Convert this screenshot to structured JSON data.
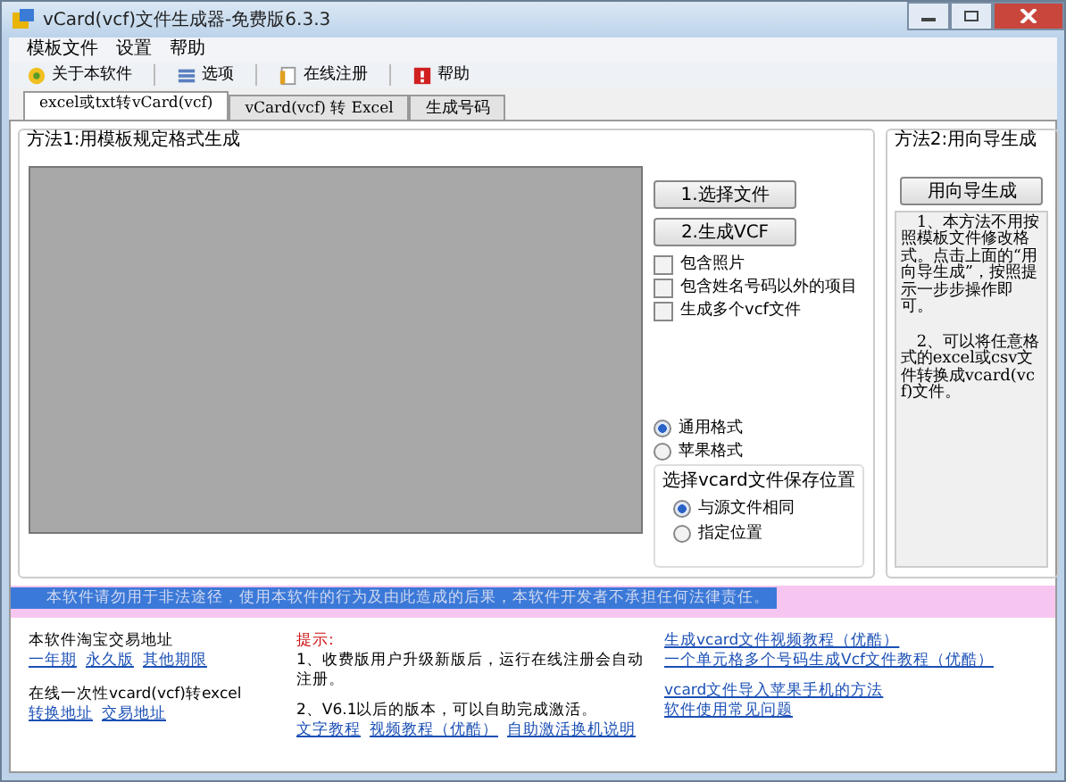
{
  "window": {
    "title": "vCard(vcf)文件生成器-免费版6.3.3"
  },
  "menu": [
    "模板文件",
    "设置",
    "帮助"
  ],
  "toolbar": [
    "关于本软件",
    "选项",
    "在线注册",
    "帮助"
  ],
  "tabs": [
    {
      "label": "excel或txt转vCard(vcf)",
      "selected": true
    },
    {
      "label": "vCard(vcf) 转 Excel",
      "selected": false
    },
    {
      "label": "生成号码",
      "selected": false
    }
  ],
  "method1": {
    "title": "方法1:用模板规定格式生成",
    "buttons": [
      "1.选择文件",
      "2.生成VCF"
    ],
    "checkboxes": [
      {
        "label": "包含照片",
        "checked": false
      },
      {
        "label": "包含姓名号码以外的项目",
        "checked": false
      },
      {
        "label": "生成多个vcf文件",
        "checked": false
      }
    ],
    "formats": [
      {
        "label": "通用格式",
        "selected": true
      },
      {
        "label": "苹果格式",
        "selected": false
      }
    ],
    "save_location": {
      "title": "选择vcard文件保存位置",
      "options": [
        {
          "label": "与源文件相同",
          "selected": true
        },
        {
          "label": "指定位置",
          "selected": false
        }
      ]
    }
  },
  "method2": {
    "title": "方法2:用向导生成",
    "button": "用向导生成",
    "notes": [
      "　1、本方法不用按照模板文件修改格式。点击上面的“用向导生成”，按照提示一步步操作即可。",
      "　2、可以将任意格式的excel或csv文件转换成vcard(vcf)文件。"
    ]
  },
  "banner": "本软件请勿用于非法途径，使用本软件的行为及由此造成的后果，本软件开发者不承担任何法律责任。",
  "footer": {
    "col1": [
      {
        "text": "本软件淘宝交易地址",
        "links": [
          "一年期",
          "永久版",
          "其他期限"
        ]
      },
      {
        "text": "在线一次性vcard(vcf)转excel",
        "links": [
          "转换地址",
          "交易地址"
        ]
      }
    ],
    "tip": {
      "title": "提示:",
      "lines": [
        "1、收费版用户升级新版后，运行在线注册会自动注册。",
        "2、V6.1以后的版本，可以自助完成激活。"
      ],
      "links": [
        "文字教程",
        "视频教程（优酷）",
        "自助激活换机说明"
      ]
    },
    "col3": [
      "生成vcard文件视频教程（优酷）",
      "一个单元格多个号码生成Vcf文件教程（优酷）",
      "vcard文件导入苹果手机的方法",
      "软件使用常见问题"
    ]
  }
}
